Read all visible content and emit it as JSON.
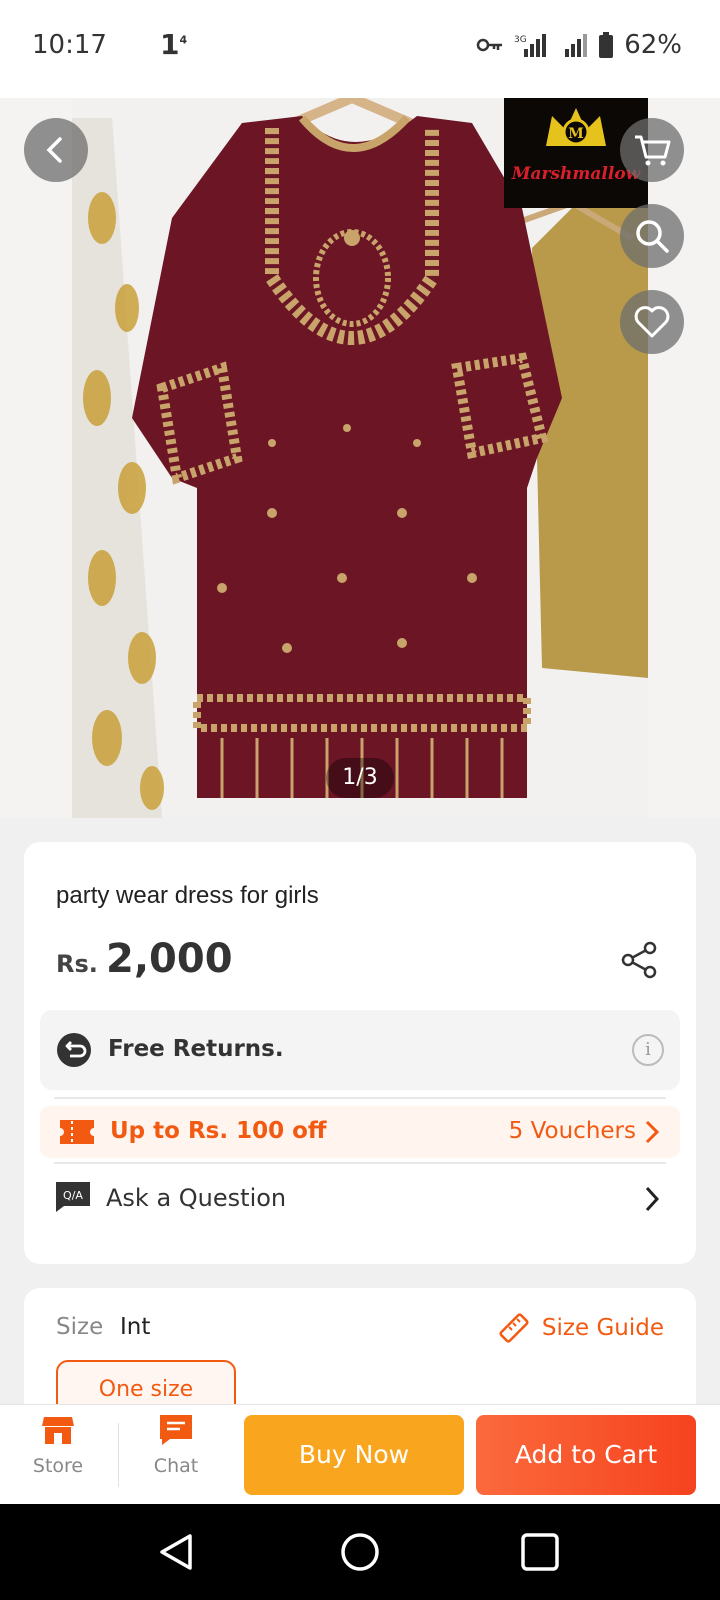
{
  "status": {
    "time": "10:17",
    "notif": "1",
    "notif_sup": "4",
    "battery": "62%"
  },
  "gallery": {
    "counter": "1/3",
    "brand": "Marshmallow",
    "brand_mark": "M"
  },
  "product": {
    "title": "party wear dress for girls",
    "currency": "Rs.",
    "price": "2,000"
  },
  "returns": {
    "label": "Free Returns.",
    "info": "i"
  },
  "voucher": {
    "label": "Up to Rs. 100 off",
    "count": "5 Vouchers"
  },
  "qa": {
    "badge": "Q/A",
    "label": "Ask a Question"
  },
  "size": {
    "label": "Size",
    "value": "Int",
    "guide": "Size Guide",
    "option": "One size"
  },
  "bottom_bar": {
    "store": "Store",
    "chat": "Chat",
    "buy_now": "Buy Now",
    "add_to_cart": "Add to Cart"
  },
  "colors": {
    "accent": "#f25a12",
    "buy_now": "#f9a51d",
    "add_to_cart": "#f6421f",
    "dress": "#6b1525"
  }
}
